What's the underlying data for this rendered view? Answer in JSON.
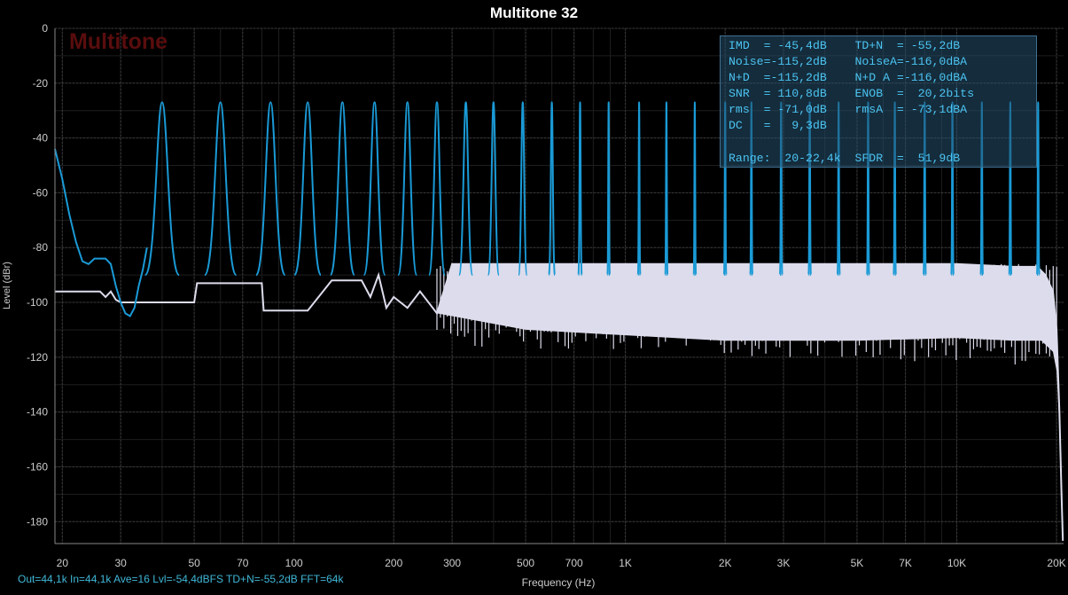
{
  "title": "Multitone 32",
  "watermark": "Multitone",
  "footer": "Out=44,1k In=44,1k Ave=16 Lvl=-54,4dBFS TD+N=-55,2dB FFT=64k",
  "colors": {
    "tones": "#1a9ad6",
    "floor": "#dcdcec",
    "stats_text": "#4cc4f2",
    "watermark": "#5a0d0d"
  },
  "stats": {
    "lines": [
      "IMD  = -45,4dB    TD+N  = -55,2dB",
      "Noise=-115,2dB    NoiseA=-116,0dBA",
      "N+D  =-115,2dB    N+D A =-116,0dBA",
      "SNR  = 110,8dB    ENOB  =  20,2bits",
      "rms  = -71,0dB    rmsA  = -73,1dBA",
      "DC   =   9,3dB",
      "",
      "Range:  20-22,4k  SFDR  =  51,9dB"
    ]
  },
  "chart_data": {
    "type": "line",
    "title": "Multitone 32",
    "xlabel": "Frequency (Hz)",
    "ylabel": "Level (dBr)",
    "xscale": "log",
    "xlim": [
      19,
      21000
    ],
    "ylim": [
      -188,
      0
    ],
    "grid": true,
    "x_ticks": [
      {
        "v": 20,
        "l": "20"
      },
      {
        "v": 30,
        "l": "30"
      },
      {
        "v": 50,
        "l": "50"
      },
      {
        "v": 70,
        "l": "70"
      },
      {
        "v": 100,
        "l": "100"
      },
      {
        "v": 200,
        "l": "200"
      },
      {
        "v": 300,
        "l": "300"
      },
      {
        "v": 500,
        "l": "500"
      },
      {
        "v": 700,
        "l": "700"
      },
      {
        "v": 1000,
        "l": "1K"
      },
      {
        "v": 2000,
        "l": "2K"
      },
      {
        "v": 3000,
        "l": "3K"
      },
      {
        "v": 5000,
        "l": "5K"
      },
      {
        "v": 7000,
        "l": "7K"
      },
      {
        "v": 10000,
        "l": "10K"
      },
      {
        "v": 20000,
        "l": "20K"
      }
    ],
    "y_ticks": [
      0,
      -20,
      -40,
      -60,
      -80,
      -100,
      -120,
      -140,
      -160,
      -180
    ],
    "series": [
      {
        "key": "tones",
        "tone_freqs": [
          40,
          60,
          85,
          110,
          140,
          175,
          220,
          270,
          330,
          400,
          490,
          600,
          730,
          890,
          1100,
          1330,
          1620,
          2000,
          2400,
          2950,
          3600,
          4400,
          5400,
          6500,
          8000,
          9700,
          11900,
          14500,
          17600
        ],
        "tone_level": -27,
        "low_end": [
          [
            19,
            -44
          ],
          [
            20,
            -55
          ],
          [
            21,
            -68
          ],
          [
            22,
            -78
          ],
          [
            23,
            -85
          ],
          [
            24,
            -86
          ],
          [
            25,
            -84
          ],
          [
            27,
            -84
          ],
          [
            28,
            -86
          ],
          [
            29,
            -94
          ],
          [
            30,
            -100
          ],
          [
            31,
            -104
          ],
          [
            32,
            -105
          ],
          [
            33,
            -102
          ],
          [
            34,
            -94
          ],
          [
            35,
            -88
          ],
          [
            36,
            -80
          ]
        ]
      },
      {
        "key": "floor",
        "floor": [
          [
            19,
            -96
          ],
          [
            26,
            -96
          ],
          [
            27,
            -98
          ],
          [
            28,
            -96
          ],
          [
            29,
            -99
          ],
          [
            30,
            -100
          ],
          [
            50,
            -100
          ],
          [
            51,
            -93
          ],
          [
            80,
            -93
          ],
          [
            81,
            -103
          ],
          [
            110,
            -103
          ],
          [
            130,
            -92
          ],
          [
            160,
            -92
          ],
          [
            170,
            -98
          ],
          [
            180,
            -90
          ],
          [
            190,
            -102
          ],
          [
            200,
            -98
          ],
          [
            220,
            -102
          ],
          [
            240,
            -96
          ],
          [
            270,
            -104
          ],
          [
            300,
            -86
          ],
          [
            500,
            -86
          ],
          [
            1000,
            -86
          ],
          [
            2000,
            -86
          ],
          [
            5000,
            -86
          ],
          [
            10000,
            -86
          ],
          [
            15000,
            -87
          ],
          [
            17500,
            -87
          ],
          [
            18500,
            -90
          ],
          [
            19500,
            -96
          ],
          [
            20000,
            -110
          ],
          [
            20400,
            -140
          ],
          [
            20700,
            -170
          ],
          [
            20900,
            -187
          ]
        ],
        "floor_lower": [
          [
            270,
            -104
          ],
          [
            500,
            -110
          ],
          [
            1000,
            -112
          ],
          [
            2000,
            -114
          ],
          [
            5000,
            -114
          ],
          [
            10000,
            -113
          ],
          [
            15000,
            -114
          ],
          [
            18000,
            -114
          ],
          [
            19500,
            -118
          ],
          [
            20000,
            -125
          ],
          [
            20500,
            -150
          ],
          [
            20900,
            -188
          ]
        ]
      }
    ]
  }
}
